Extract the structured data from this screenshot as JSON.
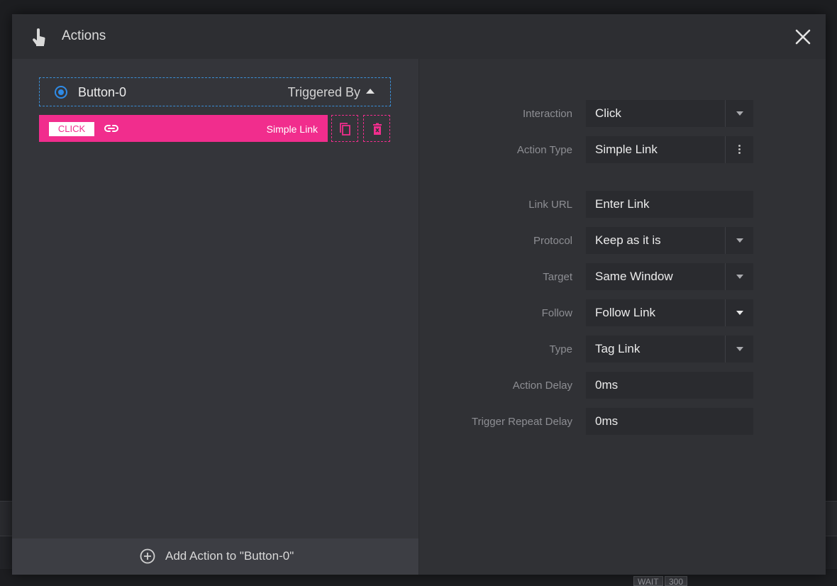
{
  "header": {
    "title": "Actions",
    "icon": "hand-pointer-icon"
  },
  "trigger": {
    "element_name": "Button-0",
    "triggered_by_label": "Triggered By"
  },
  "action_item": {
    "event_badge": "CLICK",
    "type_label": "Simple Link",
    "color": "#f12d8d"
  },
  "add_action": {
    "label": "Add Action to \"Button-0\""
  },
  "settings": [
    {
      "label": "Interaction",
      "value": "Click",
      "control": "dropdown"
    },
    {
      "label": "Action Type",
      "value": "Simple Link",
      "control": "menu"
    },
    {
      "label": "Link URL",
      "value": "Enter Link",
      "control": "input"
    },
    {
      "label": "Protocol",
      "value": "Keep as it is",
      "control": "dropdown"
    },
    {
      "label": "Target",
      "value": "Same Window",
      "control": "dropdown"
    },
    {
      "label": "Follow",
      "value": "Follow Link",
      "control": "dropdown"
    },
    {
      "label": "Type",
      "value": "Tag Link",
      "control": "dropdown"
    },
    {
      "label": "Action Delay",
      "value": "0ms",
      "control": "input"
    },
    {
      "label": "Trigger Repeat Delay",
      "value": "0ms",
      "control": "input"
    }
  ],
  "background": {
    "badges": [
      "WAIT",
      "300"
    ]
  },
  "colors": {
    "accent": "#f12d8d",
    "selection": "#2f8be6",
    "panel": "#34353a"
  }
}
